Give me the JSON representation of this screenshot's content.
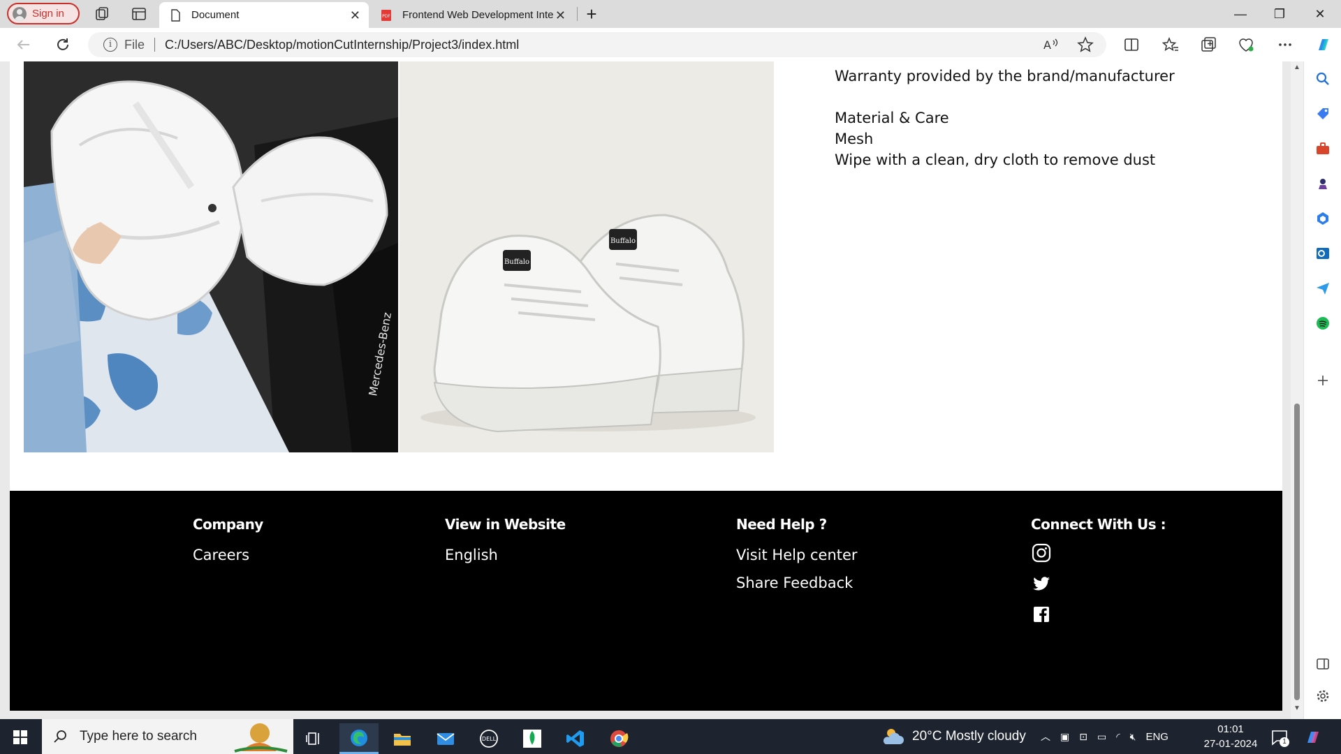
{
  "browser": {
    "signin_label": "Sign in",
    "tabs": [
      {
        "title": "Document",
        "active": true,
        "icon": "page-icon"
      },
      {
        "title": "Frontend Web Development Inte",
        "active": false,
        "icon": "pdf-icon"
      }
    ],
    "new_tab_label": "+",
    "address": {
      "scheme": "File",
      "url": "C:/Users/ABC/Desktop/motionCutInternship/Project3/index.html"
    }
  },
  "product": {
    "description_lines": [
      "Warranty provided by the brand/manufacturer",
      "",
      "Material & Care",
      "Mesh",
      "Wipe with a clean, dry cloth to remove dust"
    ],
    "car_text": "Mercedes-Benz",
    "sneaker_brand": "Buffalo"
  },
  "footer": {
    "company": {
      "heading": "Company",
      "links": [
        "Careers"
      ]
    },
    "website": {
      "heading": "View in Website",
      "links": [
        "English"
      ]
    },
    "help": {
      "heading": "Need Help ?",
      "links": [
        "Visit Help center",
        "Share Feedback"
      ]
    },
    "connect": {
      "heading": "Connect With Us :",
      "icons": [
        "instagram-icon",
        "twitter-icon",
        "facebook-icon"
      ]
    }
  },
  "taskbar": {
    "search_placeholder": "Type here to search",
    "weather": "20°C  Mostly cloudy",
    "language": "ENG",
    "time": "01:01",
    "date": "27-01-2024",
    "notification_count": "1"
  },
  "colors": {
    "footer_bg": "#000000",
    "signin_accent": "#c9302c",
    "taskbar_bg": "#1d2430"
  }
}
